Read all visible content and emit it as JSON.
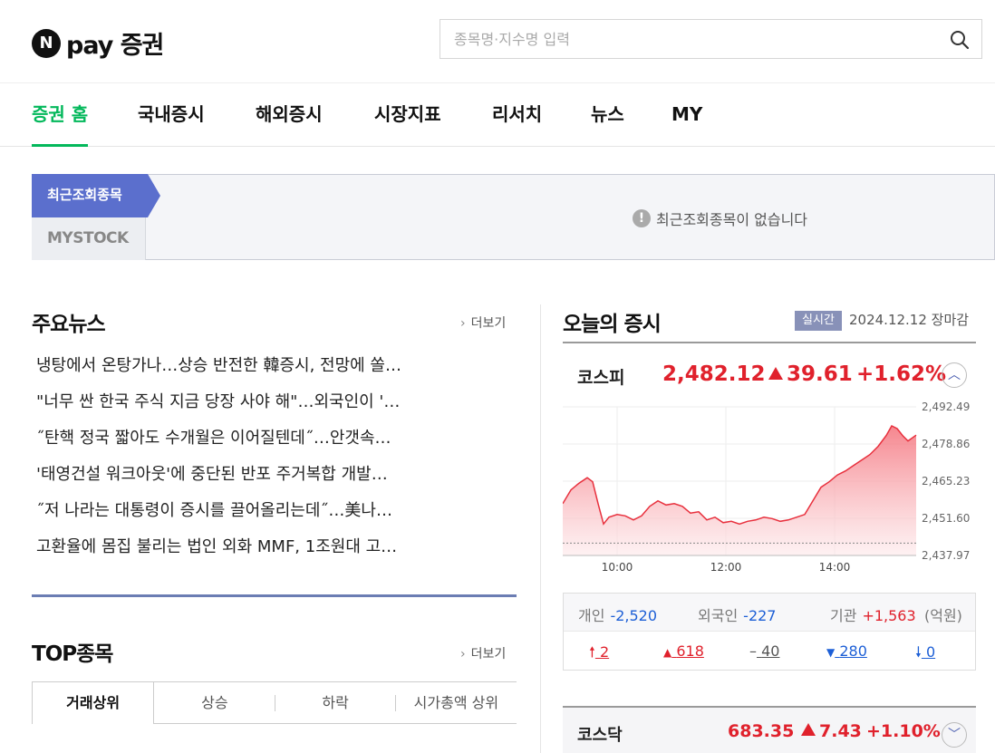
{
  "brand": {
    "logo_letter": "N",
    "name": "pay 증권"
  },
  "search": {
    "placeholder": "종목명·지수명 입력",
    "icon": "search-icon"
  },
  "nav": [
    {
      "label": "증권 홈",
      "active": true
    },
    {
      "label": "국내증시"
    },
    {
      "label": "해외증시"
    },
    {
      "label": "시장지표"
    },
    {
      "label": "리서치"
    },
    {
      "label": "뉴스"
    },
    {
      "label": "MY"
    }
  ],
  "recent": {
    "tab_recent": "최근조회종목",
    "tab_mystock": "MYSTOCK",
    "empty_message": "최근조회종목이 없습니다"
  },
  "news": {
    "title": "주요뉴스",
    "more": "더보기",
    "items": [
      "냉탕에서 온탕가나…상승 반전한 韓증시, 전망에 쏠…",
      "\"너무 싼 한국 주식 지금 당장 사야 해\"…외국인이 '…",
      "˝탄핵 정국 짧아도 수개월은 이어질텐데˝…안갯속…",
      "'태영건설 워크아웃'에 중단된 반포 주거복합 개발…",
      "˝저 나라는 대통령이 증시를 끌어올리는데˝…美나…",
      "고환율에 몸집 불리는 법인 외화 MMF, 1조원대 고…"
    ]
  },
  "top": {
    "title": "TOP종목",
    "more": "더보기",
    "tabs": [
      "거래상위",
      "상승",
      "하락",
      "시가총액 상위"
    ]
  },
  "market": {
    "title": "오늘의 증시",
    "badge": "실시간",
    "date": "2024.12.12",
    "status": "장마감",
    "kospi": {
      "name": "코스피",
      "value": "2,482.12",
      "change": "39.61",
      "rate": "+1.62%",
      "toggle": "chevron-up-icon"
    },
    "investors": {
      "individual_label": "개인",
      "individual": "-2,520",
      "foreign_label": "외국인",
      "foreign": "-227",
      "institution_label": "기관",
      "institution": "+1,563",
      "unit": "(억원)"
    },
    "breadth": {
      "upper_limit": "2",
      "up": "618",
      "flat": "40",
      "down": "280",
      "lower_limit": "0"
    },
    "kosdaq": {
      "name": "코스닥",
      "value": "683.35",
      "change": "7.43",
      "rate": "+1.10%",
      "toggle": "chevron-down-icon"
    },
    "colors": {
      "up": "#e0212c",
      "down": "#1d5fd6",
      "accent": "#03b85b"
    }
  },
  "chart_data": {
    "type": "area",
    "title": "",
    "xlabel": "",
    "ylabel": "",
    "x_ticks": [
      "10:00",
      "12:00",
      "14:00"
    ],
    "y_ticks": [
      "2,492.49",
      "2,478.86",
      "2,465.23",
      "2,451.60",
      "2,437.97"
    ],
    "ylim": [
      2437.97,
      2492.49
    ],
    "x_range_hours": [
      9.0,
      15.5
    ],
    "baseline": 2442.51,
    "series": [
      {
        "x": [
          9.0,
          9.15,
          9.3,
          9.45,
          9.55,
          9.65,
          9.75,
          9.85,
          10.0,
          10.15,
          10.3,
          10.45,
          10.6,
          10.75,
          10.9,
          11.05,
          11.2,
          11.35,
          11.5,
          11.65,
          11.8,
          11.95,
          12.1,
          12.25,
          12.4,
          12.55,
          12.7,
          12.85,
          13.0,
          13.15,
          13.3,
          13.45,
          13.6,
          13.75,
          13.9,
          14.05,
          14.2,
          14.35,
          14.5,
          14.65,
          14.8,
          14.95,
          15.05,
          15.15,
          15.25,
          15.35,
          15.5
        ],
        "y": [
          2457.0,
          2462.0,
          2464.5,
          2466.5,
          2465.0,
          2457.0,
          2449.5,
          2452.0,
          2453.0,
          2452.5,
          2451.0,
          2452.5,
          2456.0,
          2458.0,
          2456.5,
          2457.0,
          2456.0,
          2453.5,
          2454.0,
          2451.0,
          2452.0,
          2450.0,
          2450.5,
          2449.5,
          2450.5,
          2451.0,
          2452.0,
          2451.5,
          2450.5,
          2451.0,
          2452.0,
          2453.0,
          2458.0,
          2463.0,
          2465.0,
          2467.5,
          2469.0,
          2471.0,
          2473.0,
          2475.0,
          2478.0,
          2482.0,
          2485.5,
          2484.5,
          2482.0,
          2480.0,
          2482.12
        ]
      }
    ]
  }
}
